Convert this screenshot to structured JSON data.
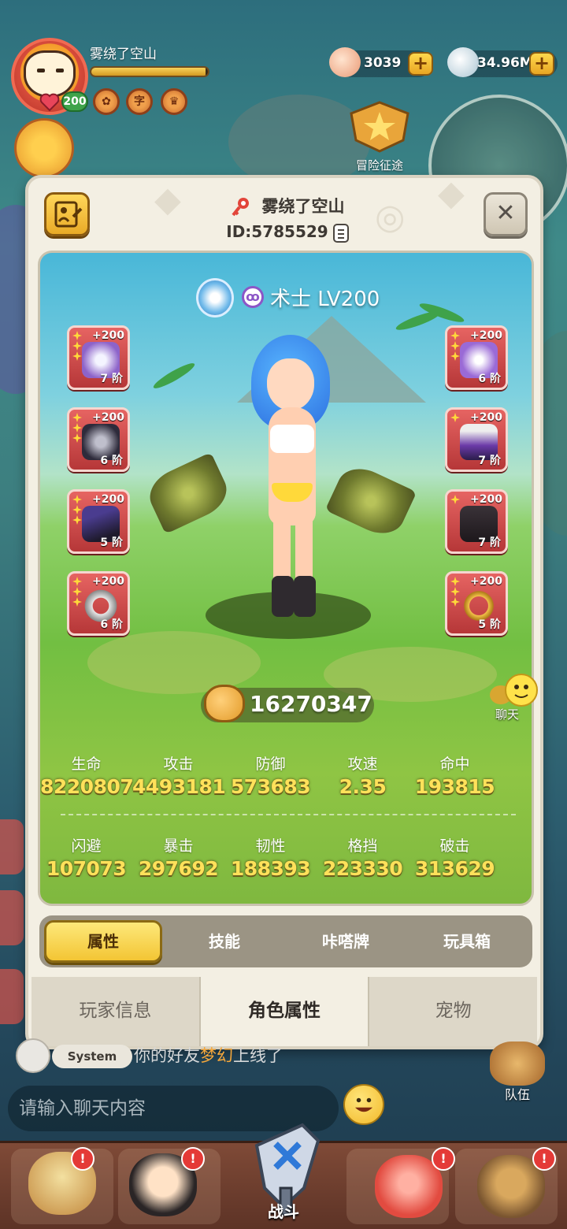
{
  "hud": {
    "player_name": "雾绕了空山",
    "level": "200",
    "exp_fraction": 0.98,
    "currencies": [
      {
        "icon": "shell-currency-icon",
        "value": "3039"
      },
      {
        "icon": "pearl-currency-icon",
        "value": "34.96M"
      }
    ],
    "adventure_label": "冒险征途"
  },
  "panel": {
    "name": "雾绕了空山",
    "id": "ID:5785529",
    "close_label": "✕",
    "class_label": "术士 LV200",
    "class_icon_glyph": "ꝏ",
    "power": "16270347",
    "equipment_left": [
      {
        "plus": "+200",
        "tier": "7 阶",
        "item": "staff-icon"
      },
      {
        "plus": "+200",
        "tier": "6 阶",
        "item": "beast-helmet-icon"
      },
      {
        "plus": "+200",
        "tier": "5 阶",
        "item": "witch-hat-icon"
      },
      {
        "plus": "+200",
        "tier": "6 阶",
        "item": "ring-icon"
      }
    ],
    "equipment_right": [
      {
        "plus": "+200",
        "tier": "6 阶",
        "item": "wand-icon"
      },
      {
        "plus": "+200",
        "tier": "7 阶",
        "item": "robe-icon"
      },
      {
        "plus": "+200",
        "tier": "7 阶",
        "item": "boots-icon"
      },
      {
        "plus": "+200",
        "tier": "5 阶",
        "item": "necklace-icon"
      }
    ],
    "stats_row1": [
      {
        "label": "生命",
        "value": "8220807"
      },
      {
        "label": "攻击",
        "value": "4493181"
      },
      {
        "label": "防御",
        "value": "573683"
      },
      {
        "label": "攻速",
        "value": "2.35"
      },
      {
        "label": "命中",
        "value": "193815"
      }
    ],
    "stats_row2": [
      {
        "label": "闪避",
        "value": "107073"
      },
      {
        "label": "暴击",
        "value": "297692"
      },
      {
        "label": "韧性",
        "value": "188393"
      },
      {
        "label": "格挡",
        "value": "223330"
      },
      {
        "label": "破击",
        "value": "313629"
      }
    ],
    "subtabs": [
      "属性",
      "技能",
      "咔嗒牌",
      "玩具箱"
    ],
    "active_subtab": 0,
    "maintabs": [
      "玩家信息",
      "角色属性",
      "宠物"
    ],
    "active_maintab": 1
  },
  "chat": {
    "system_tag": "System",
    "system_msg_prefix": "你的好友",
    "system_msg_friend": "梦幻",
    "system_msg_suffix": "上线了",
    "input_placeholder": "请输入聊天内容",
    "side_label": "聊天",
    "team_label": "队伍"
  },
  "bottom": {
    "battle_label": "战斗",
    "bell_glyph": "!"
  },
  "colors": {
    "accent_gold": "#ffe15a",
    "slot_red": "#d24a4a",
    "panel_bg": "#f3efe3"
  }
}
